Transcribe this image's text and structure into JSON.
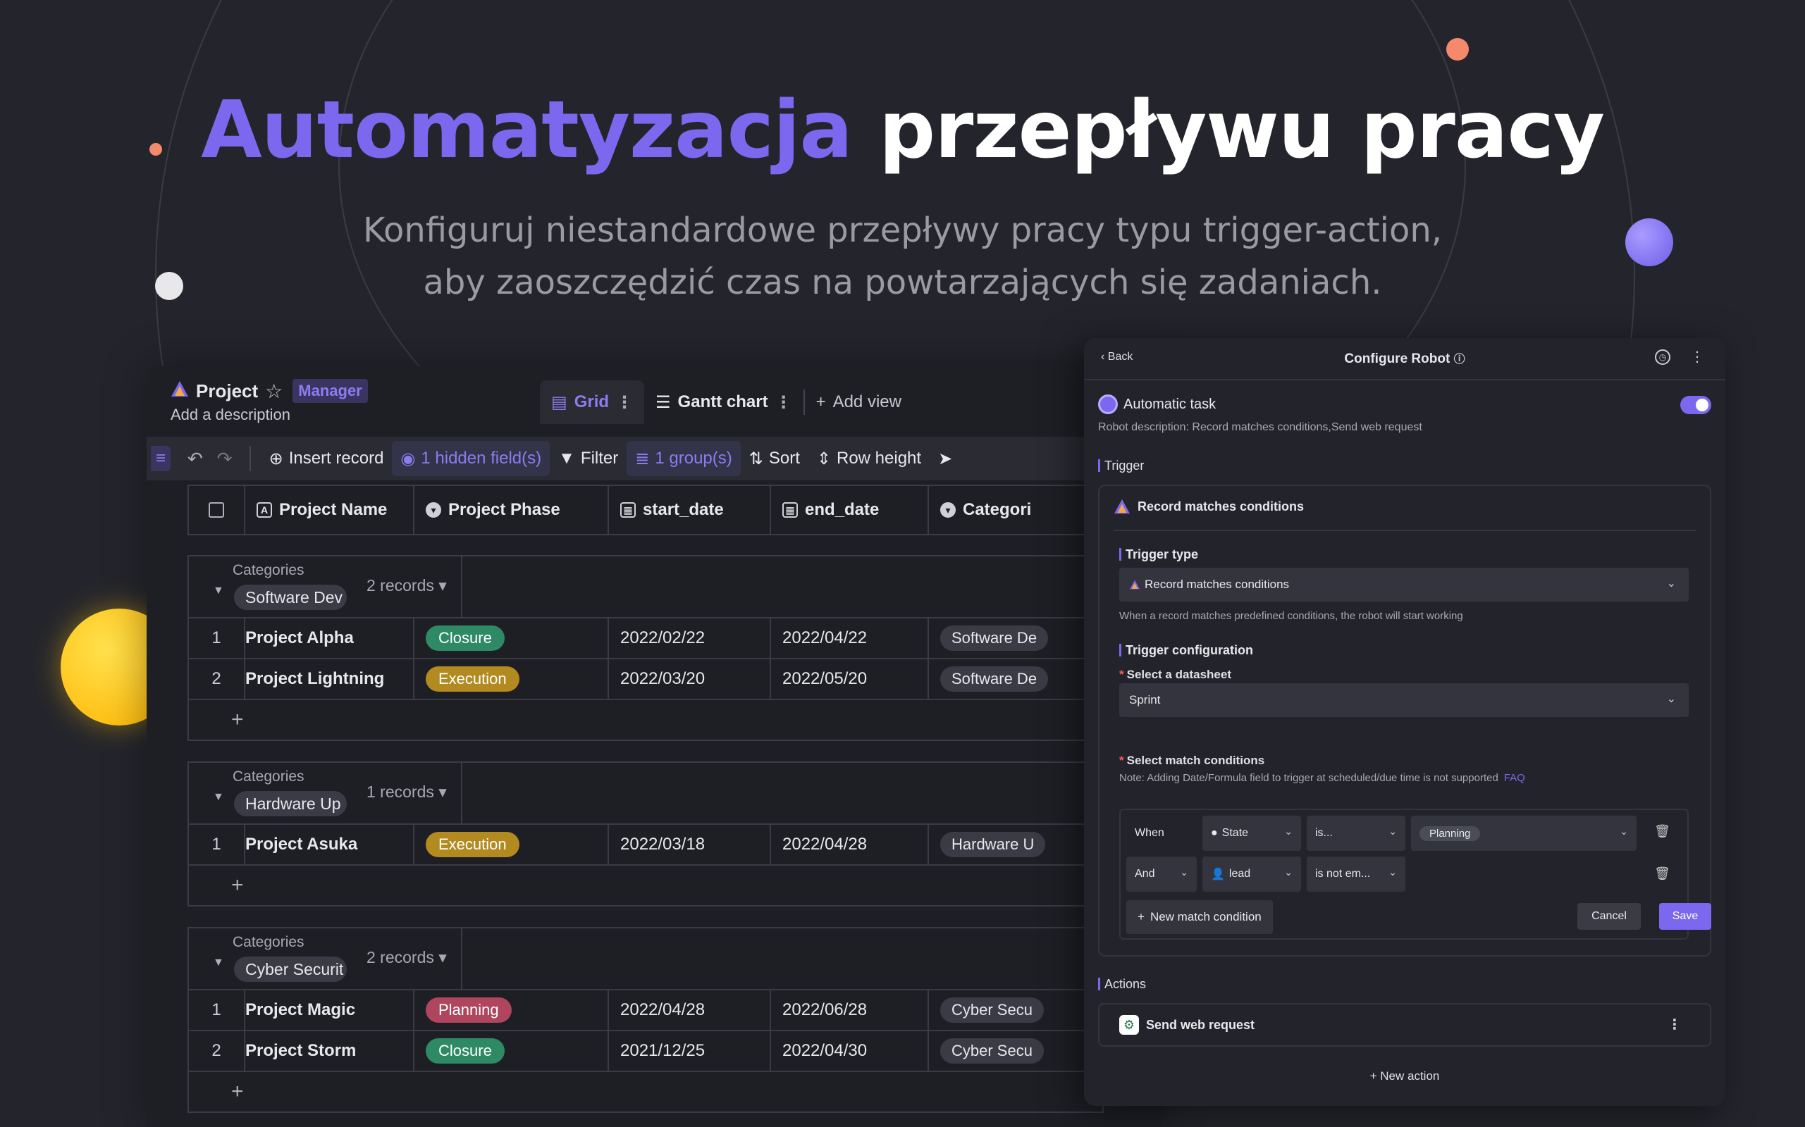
{
  "hero": {
    "title_accent": "Automatyzacja",
    "title_rest": "przepływu pracy",
    "subtitle_line1": "Konfiguruj niestandardowe przepływy pracy typu trigger-action,",
    "subtitle_line2": "aby zaoszczędzić czas na powtarzających się zadaniach."
  },
  "colors": {
    "accent": "#7b68ee",
    "background": "#24252c",
    "sun": "#ffc107",
    "peach": "#f4896b"
  },
  "header": {
    "project_title": "Project",
    "role_badge": "Manager",
    "description": "Add a description",
    "tabs": [
      {
        "label": "Grid"
      },
      {
        "label": "Gantt chart"
      }
    ],
    "add_view": "Add view"
  },
  "toolbar": {
    "insert_record": "Insert record",
    "hidden_fields": "1 hidden field(s)",
    "filter": "Filter",
    "groups": "1 group(s)",
    "sort": "Sort",
    "row_height": "Row height"
  },
  "grid": {
    "columns": [
      "Project Name",
      "Project Phase",
      "start_date",
      "end_date",
      "Categori"
    ],
    "group_label": "Categories",
    "groups": [
      {
        "category": "Software Dev",
        "count": "2 records",
        "rows": [
          {
            "num": "1",
            "name": "Project Alpha",
            "phase": "Closure",
            "phase_color": "#2e8a64",
            "start": "2022/02/22",
            "end": "2022/04/22",
            "category": "Software De"
          },
          {
            "num": "2",
            "name": "Project Lightning",
            "phase": "Execution",
            "phase_color": "#b38a1f",
            "start": "2022/03/20",
            "end": "2022/05/20",
            "category": "Software De"
          }
        ]
      },
      {
        "category": "Hardware Up",
        "count": "1 records",
        "rows": [
          {
            "num": "1",
            "name": "Project Asuka",
            "phase": "Execution",
            "phase_color": "#b38a1f",
            "start": "2022/03/18",
            "end": "2022/04/28",
            "category": "Hardware U"
          }
        ]
      },
      {
        "category": "Cyber Securit",
        "count": "2 records",
        "rows": [
          {
            "num": "1",
            "name": "Project Magic",
            "phase": "Planning",
            "phase_color": "#b0465e",
            "start": "2022/04/28",
            "end": "2022/06/28",
            "category": "Cyber Secu"
          },
          {
            "num": "2",
            "name": "Project Storm",
            "phase": "Closure",
            "phase_color": "#2e8a64",
            "start": "2021/12/25",
            "end": "2022/04/30",
            "category": "Cyber Secu"
          }
        ]
      }
    ]
  },
  "robot": {
    "back": "Back",
    "title": "Configure Robot",
    "task_name": "Automatic task",
    "description": "Robot description: Record matches conditions,Send web request",
    "trigger_section": "Trigger",
    "trigger_name": "Record matches conditions",
    "trigger_type_label": "Trigger type",
    "trigger_type_value": "Record matches conditions",
    "trigger_type_hint": "When a record matches predefined conditions, the robot will start working",
    "trigger_config_label": "Trigger configuration",
    "datasheet_label": "Select a datasheet",
    "datasheet_value": "Sprint",
    "match_label": "Select match conditions",
    "match_note": "Note: Adding Date/Formula field to trigger at scheduled/due time is not supported",
    "faq": "FAQ",
    "cond1": {
      "joiner": "When",
      "field": "State",
      "op": "is...",
      "value": "Planning"
    },
    "cond2": {
      "joiner": "And",
      "field": "lead",
      "op": "is not em..."
    },
    "new_condition": "New match condition",
    "cancel": "Cancel",
    "save": "Save",
    "actions_section": "Actions",
    "action_name": "Send web request",
    "new_action": "New action"
  }
}
